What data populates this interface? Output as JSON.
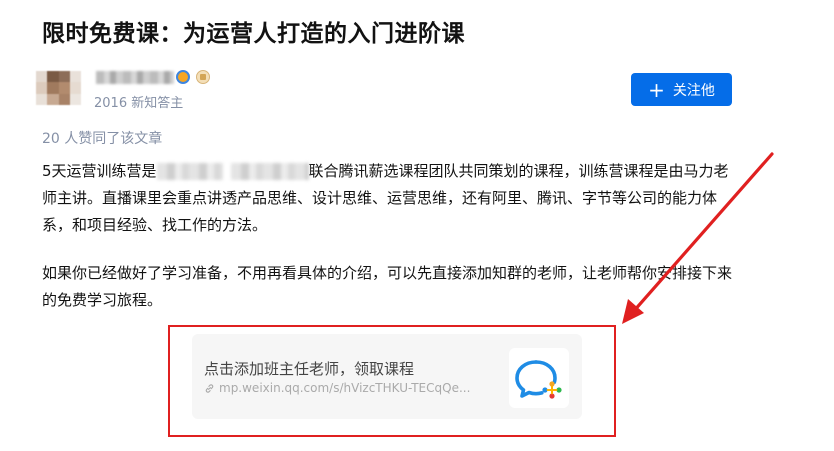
{
  "article": {
    "title": "限时免费课：为运营人打造的入门进阶课",
    "author_desc": "2016 新知答主",
    "follow_label": "关注他",
    "likes": "20 人赞同了该文章",
    "paragraph1_a": "5天运营训练营是",
    "paragraph1_b": "联合腾讯薪选课程团队共同策划的课程，训练营课程是由马力老师主讲。直播课里会重点讲透产品思维、设计思维、运营思维，还有阿里、腾讯、字节等公司的能力体系，和项目经验、找工作的方法。",
    "paragraph2": "如果你已经做好了学习准备，不用再看具体的介绍，可以先直接添加知群的老师，让老师帮你安排接下来的免费学习旅程。"
  },
  "link_card": {
    "title": "点击添加班主任老师，领取课程",
    "url": "mp.weixin.qq.com/s/hVizcTHKU-TECqQe...",
    "icon": "wecom-logo-icon"
  },
  "annotation": {
    "color": "#e02020"
  },
  "colors": {
    "accent": "#056de8",
    "muted_text": "#8590a6"
  }
}
